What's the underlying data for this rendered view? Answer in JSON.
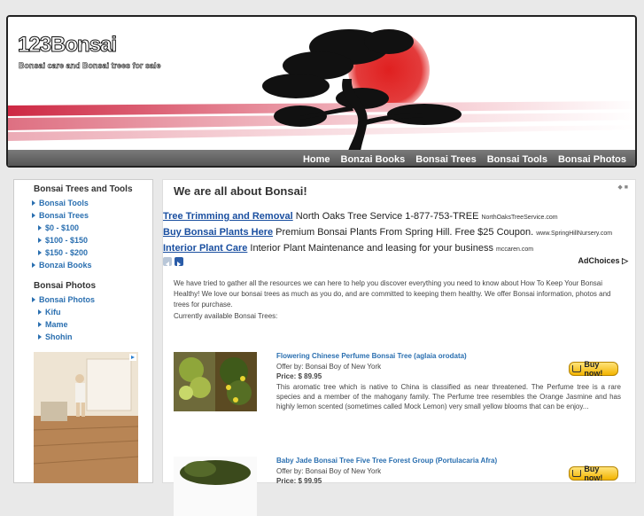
{
  "header": {
    "site_title": "123Bonsai",
    "tagline": "Bonsai care and Bonsai trees for sale"
  },
  "nav": [
    "Home",
    "Bonzai Books",
    "Bonsai Trees",
    "Bonsai Tools",
    "Bonsai Photos"
  ],
  "sidebar": {
    "section1_title": "Bonsai Trees and Tools",
    "section1_items": [
      "Bonsai Tools",
      "Bonsai Trees",
      "$0 - $100",
      "$100 - $150",
      "$150 - $200",
      "Bonzai Books"
    ],
    "section2_title": "Bonsai Photos",
    "section2_items": [
      "Bonsai Photos",
      "Kifu",
      "Mame",
      "Shohin"
    ]
  },
  "main": {
    "title": "We are all about Bonsai!",
    "ads": [
      {
        "link": "Tree Trimming and Removal",
        "text": "North Oaks Tree Service 1-877-753-TREE",
        "url": "NorthOaksTreeService.com"
      },
      {
        "link": "Buy Bonsai Plants Here",
        "text": "Premium Bonsai Plants From Spring Hill. Free $25 Coupon.",
        "url": "www.SpringHillNursery.com"
      },
      {
        "link": "Interior Plant Care",
        "text": "Interior Plant Maintenance and leasing for your business",
        "url": "mccaren.com"
      }
    ],
    "adchoices": "AdChoices",
    "intro": "We have tried to gather all the resources we can here to help you discover everything you need to know about How To Keep Your Bonsai Healthy! We love our bonsai trees as much as you do, and are committed to keeping them healthy. We offer Bonsai information, photos and trees for purchase.",
    "available_label": "Currently available Bonsai Trees:",
    "buy_label": "Buy now!",
    "products": [
      {
        "title": "Flowering Chinese Perfume Bonsai Tree (aglaia orodata)",
        "offer": "Offer by: Bonsai Boy of New York",
        "price": "Price: $ 89.95",
        "desc": "This aromatic tree which is native to China is classified as near threatened. The Perfume tree is a rare species and a member of the mahogany family. The Perfume tree resembles the Orange Jasmine and has highly lemon scented (sometimes called Mock Lemon) very small yellow blooms that can be enjoy..."
      },
      {
        "title": "Baby Jade Bonsai Tree Five Tree Forest Group (Portulacaria Afra)",
        "offer": "Offer by: Bonsai Boy of New York",
        "price": "Price: $ 99.95",
        "desc": ""
      }
    ]
  },
  "colors": {
    "link_blue": "#2a6fb0",
    "sun_red": "#d42a2a",
    "buy_gold": "#f3b400"
  }
}
